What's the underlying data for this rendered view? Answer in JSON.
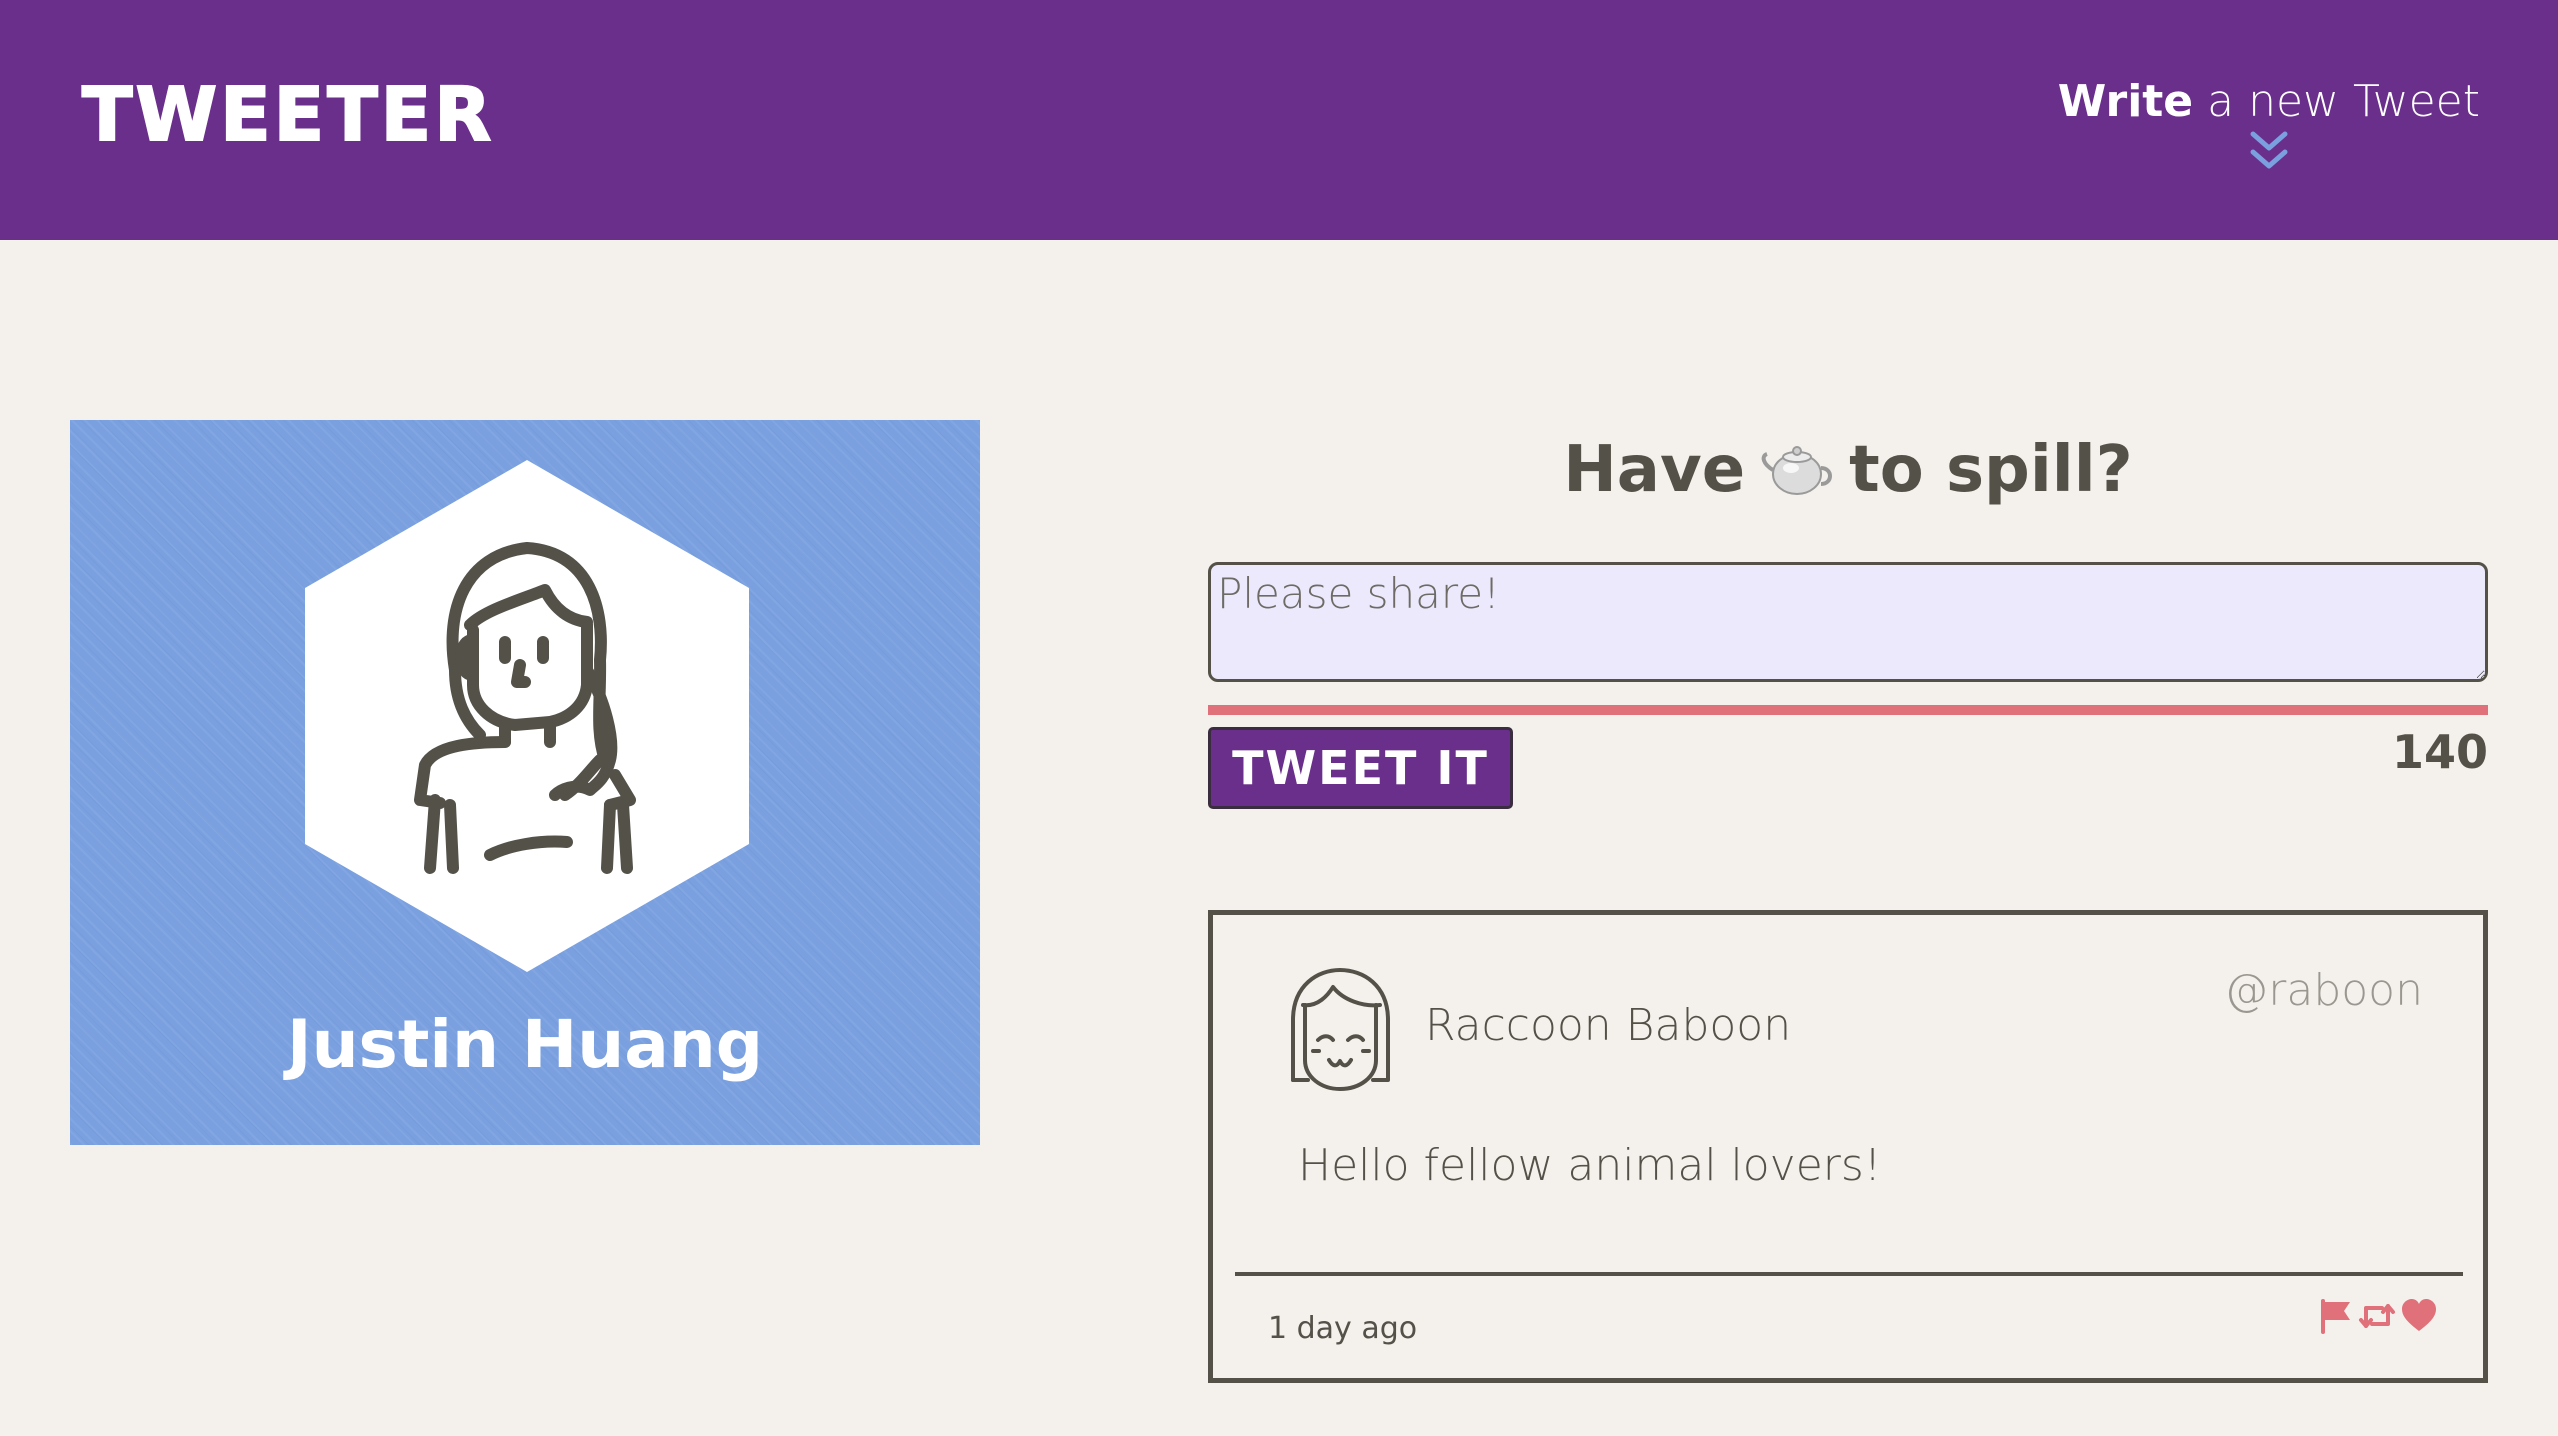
{
  "nav": {
    "logo": "TWEETER",
    "compose_toggle": {
      "label_strong": "Write",
      "label_rest": " a new Tweet",
      "icon": "double-chevron-down-icon"
    }
  },
  "profile": {
    "name": "Justin Huang",
    "avatar_icon": "girl-avatar-icon"
  },
  "compose": {
    "heading_before": "Have",
    "heading_icon": "teapot-icon",
    "heading_after": "to spill?",
    "placeholder": "Please share!",
    "button_label": "TWEET IT",
    "char_count": "140"
  },
  "tweets": [
    {
      "author": "Raccoon Baboon",
      "handle": "@raboon",
      "content": "Hello fellow animal lovers!",
      "time": "1 day ago",
      "actions": [
        "flag-icon",
        "retweet-icon",
        "heart-icon"
      ]
    }
  ],
  "colors": {
    "nav_bg": "#6a2f8b",
    "page_bg": "#f4f1ec",
    "profile_bg": "#7aa0e0",
    "input_bg": "#ebe9fb",
    "error_bar": "#e0707a",
    "text": "#545149",
    "action_icons": "#e0707a",
    "chevron": "#7aa0e0"
  }
}
